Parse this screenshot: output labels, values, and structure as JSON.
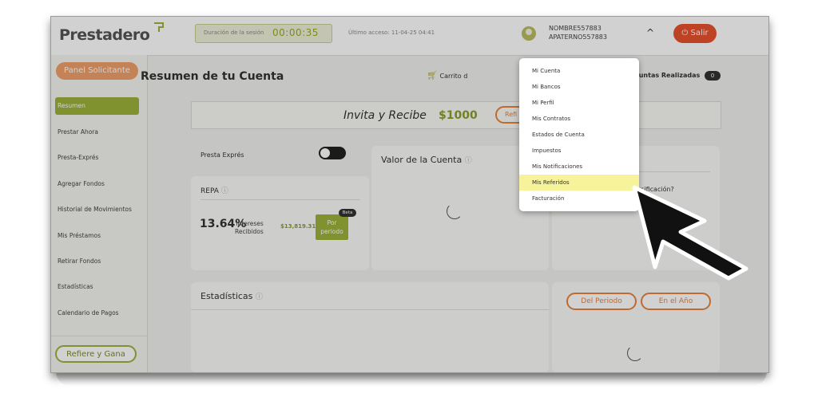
{
  "topbar": {
    "logo": "Prestadero",
    "session_label": "Duración de la sesión",
    "session_time": "00:00:35",
    "last_access": "Último acceso: 11-04-25 04:41",
    "user_line1": "NOMBRE557883",
    "user_line2": "APATERNO557883",
    "logout_label": "Salir",
    "chevron": "^"
  },
  "sidebar": {
    "panel_button": "Panel Solicitante",
    "items": [
      {
        "label": "Resumen",
        "active": true
      },
      {
        "label": "Prestar Ahora"
      },
      {
        "label": "Presta-Exprés"
      },
      {
        "label": "Agregar Fondos"
      },
      {
        "label": "Historial de Movimientos"
      },
      {
        "label": "Mis Préstamos"
      },
      {
        "label": "Retirar Fondos"
      },
      {
        "label": "Estadísticas"
      },
      {
        "label": "Calendario de Pagos"
      }
    ],
    "refiere_button": "Refiere y Gana"
  },
  "main": {
    "title": "Resumen de tu Cuenta",
    "cart_label": "Carrito d",
    "preguntas_label": "guntas Realizadas",
    "preguntas_count": "0",
    "invita": {
      "text": "Invita y Recibe",
      "amount": "$1000",
      "button": "Refi"
    },
    "presta_expres": "Presta Exprés",
    "valor_title": "Valor de la Cuenta",
    "repa": {
      "title": "REPA",
      "value": "13.64%",
      "label_line1": "Intereses",
      "label_line2": "Recibidos",
      "amount": "$13,819.31",
      "btn_line1": "Por",
      "btn_line2": "periodo",
      "beta": "Beta"
    },
    "estadisticas_title": "Estadísticas",
    "diversificacion": "ersificación?",
    "period_buttons": [
      "Del Periodo",
      "En el Año"
    ]
  },
  "dropdown": {
    "items": [
      {
        "label": "Mi Cuenta"
      },
      {
        "label": "Mi Bancos"
      },
      {
        "label": "Mi Perfil"
      },
      {
        "label": "Mis Contratos"
      },
      {
        "label": "Estados de Cuenta"
      },
      {
        "label": "Impuestos"
      },
      {
        "label": "Mis Notificaciones"
      },
      {
        "label": "Mis Referidos",
        "highlighted": true
      },
      {
        "label": "Facturación"
      }
    ]
  },
  "colors": {
    "brand_green": "#9db33b",
    "accent_orange": "#e8823b",
    "logout_red": "#e8512d",
    "highlight": "#f6f39a"
  }
}
